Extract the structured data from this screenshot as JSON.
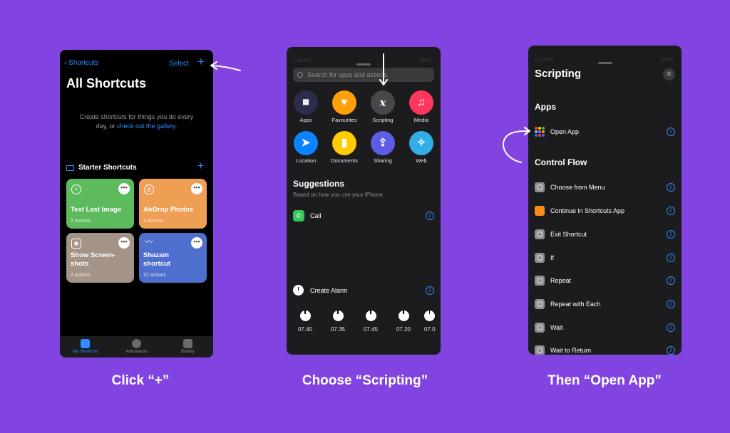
{
  "panel1": {
    "back_label": "Shortcuts",
    "select_label": "Select",
    "plus": "+",
    "title": "All Shortcuts",
    "desc_line1": "Create shortcuts for things you do every",
    "desc_line2_prefix": "day, or",
    "desc_link": "check out the gallery.",
    "section_title": "Starter Shortcuts",
    "section_plus": "+",
    "cards": [
      {
        "title": "Text Last Image",
        "sub": "2 actions",
        "color": "#5dbb5d"
      },
      {
        "title": "AirDrop Photos",
        "sub": "3 actions",
        "color": "#ee9f54"
      },
      {
        "title": "Show Screen-shots",
        "title_l1": "Show Screen-",
        "title_l2": "shots",
        "sub": "2 actions",
        "color": "#a49488"
      },
      {
        "title": "Shazam shortcut",
        "title_l1": "Shazam",
        "title_l2": "shortcut",
        "sub": "32 actions",
        "color": "#4e6fce"
      }
    ],
    "tabs": [
      "My Shortcuts",
      "Automation",
      "Gallery"
    ]
  },
  "panel2": {
    "cancel_label": "Cancel",
    "next_label": "Next",
    "search_placeholder": "Search for apps and actions",
    "categories": [
      {
        "label": "Apps",
        "icon": "apps-grid-icon",
        "color": "#2c2c4e"
      },
      {
        "label": "Favourites",
        "icon": "heart-icon",
        "color": "#ff9f0a"
      },
      {
        "label": "Scripting",
        "icon": "x-script-icon",
        "color": "#48484a"
      },
      {
        "label": "Media",
        "icon": "music-note-icon",
        "color": "#ff375f"
      },
      {
        "label": "Location",
        "icon": "location-arrow-icon",
        "color": "#0a84ff"
      },
      {
        "label": "Documents",
        "icon": "document-icon",
        "color": "#ffcc00"
      },
      {
        "label": "Sharing",
        "icon": "share-icon",
        "color": "#5e5ce6"
      },
      {
        "label": "Web",
        "icon": "compass-icon",
        "color": "#32ade6"
      }
    ],
    "suggestions_title": "Suggestions",
    "suggestions_sub": "Based on how you use your iPhone.",
    "call_label": "Call",
    "alarm_label": "Create Alarm",
    "alarms": [
      "07.40",
      "07.35",
      "07.45",
      "07.20",
      "07.0"
    ]
  },
  "panel3": {
    "cancel_label": "Cancel",
    "next_label": "Next",
    "title": "Scripting",
    "close": "✕",
    "apps_section": "Apps",
    "open_app": "Open App",
    "control_section": "Control Flow",
    "items": [
      "Choose from Menu",
      "Continue in Shortcuts App",
      "Exit Shortcut",
      "If",
      "Repeat",
      "Repeat with Each",
      "Wait",
      "Wait to Return"
    ]
  },
  "captions": [
    "Click “+”",
    "Choose “Scripting”",
    "Then “Open App”"
  ]
}
